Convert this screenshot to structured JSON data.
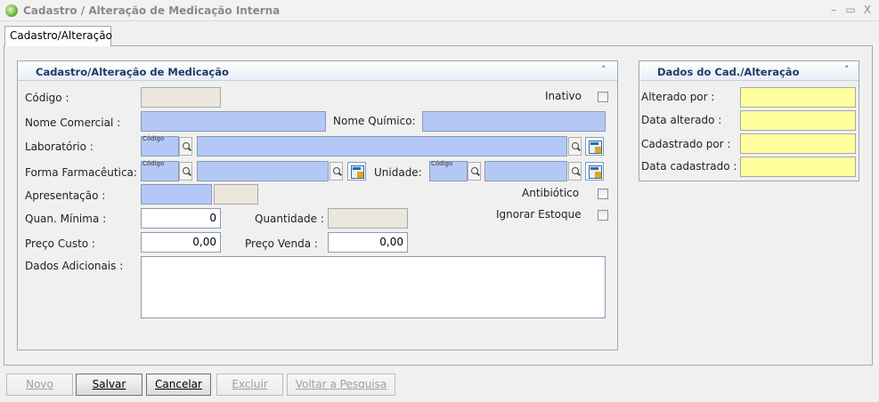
{
  "window": {
    "title": "Cadastro / Alteração de Medicação Interna",
    "controls": [
      "–",
      "▭",
      "X"
    ]
  },
  "tab": {
    "label": "Cadastro/Alteração"
  },
  "main_panel": {
    "title": "Cadastro/Alteração de Medicação",
    "codigo_label": "Código :",
    "inativo_label": "Inativo",
    "nome_comercial_label": "Nome Comercial :",
    "nome_quimico_label": "Nome Químico:",
    "laboratorio_label": "Laboratório :",
    "forma_label": "Forma Farmacêutica:",
    "unidade_label": "Unidade:",
    "apresentacao_label": "Apresentação :",
    "antibiotico_label": "Antibiótico",
    "ignorar_label": "Ignorar Estoque",
    "quan_minima_label": "Quan. Mínima :",
    "quan_minima_value": "0",
    "quantidade_label": "Quantidade :",
    "preco_custo_label": "Preço Custo :",
    "preco_custo_value": "0,00",
    "preco_venda_label": "Preço Venda :",
    "preco_venda_value": "0,00",
    "dados_adicionais_label": "Dados Adicionais :",
    "code_hint": "Código"
  },
  "side_panel": {
    "title": "Dados do Cad./Alteração",
    "alterado_por_label": "Alterado por :",
    "data_alterado_label": "Data alterado :",
    "cadastrado_por_label": "Cadastrado por :",
    "data_cadastrado_label": "Data cadastrado :"
  },
  "buttons": {
    "novo": "Novo",
    "salvar": "Salvar",
    "cancelar": "Cancelar",
    "excluir": "Excluir",
    "voltar": "Voltar a Pesquisa"
  },
  "colors": {
    "field_blue": "#b4c8f7",
    "field_yellow": "#ffff9e",
    "field_readonly": "#ebe7dc",
    "panel_title": "#1d3b6a"
  }
}
